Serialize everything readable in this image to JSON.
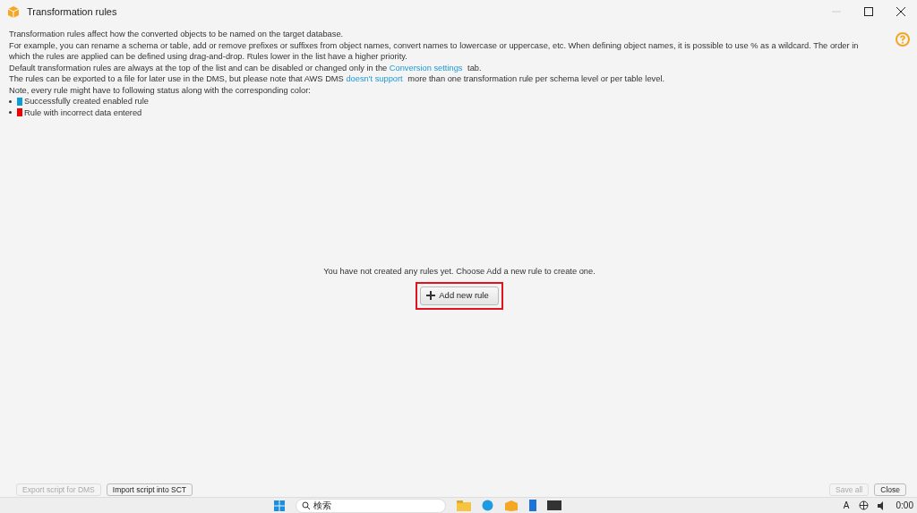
{
  "window": {
    "title": "Transformation rules"
  },
  "description": [
    {
      "text": "Transformation rules affect how the converted objects to be named on the target database."
    },
    {
      "text": "For example, you can rename a schema or table, add or remove prefixes or suffixes from object names, convert names to lowercase or uppercase, etc. When defining object names, it is possible to use % as a wildcard. The order in which the rules are applied can be defined using drag-and-drop. Rules lower in the list have a higher priority."
    },
    {
      "text": "Default transformation rules are always at the top of the list and can be disabled or changed only in the ",
      "link": "Conversion settings",
      "after": " tab."
    },
    {
      "text": "The rules can be exported to a file for later use in the DMS, but please note that AWS DMS ",
      "link": "doesn't support",
      "after": " more than one transformation rule per schema level or per table level."
    },
    {
      "text": "Note, every rule might have to following status along with the corresponding color:"
    }
  ],
  "legend": [
    {
      "color": "#0e9bd6",
      "label": "Successfully created enabled rule"
    },
    {
      "color": "#f00000",
      "label": "Rule with incorrect data entered"
    }
  ],
  "empty_message": "You have not created any rules yet. Choose Add a new rule to create one.",
  "add_button": {
    "label": "Add new rule",
    "highlighted": true
  },
  "footer_left_buttons": [
    {
      "label": "Export script for DMS",
      "disabled": true
    },
    {
      "label": "Import script into SCT",
      "disabled": false
    }
  ],
  "footer_right_buttons": [
    {
      "label": "Save all",
      "disabled": true
    },
    {
      "label": "Close",
      "disabled": false
    }
  ],
  "taskbar": {
    "search_placeholder": "検索",
    "clock": "0:00",
    "input_indicator": "A"
  }
}
